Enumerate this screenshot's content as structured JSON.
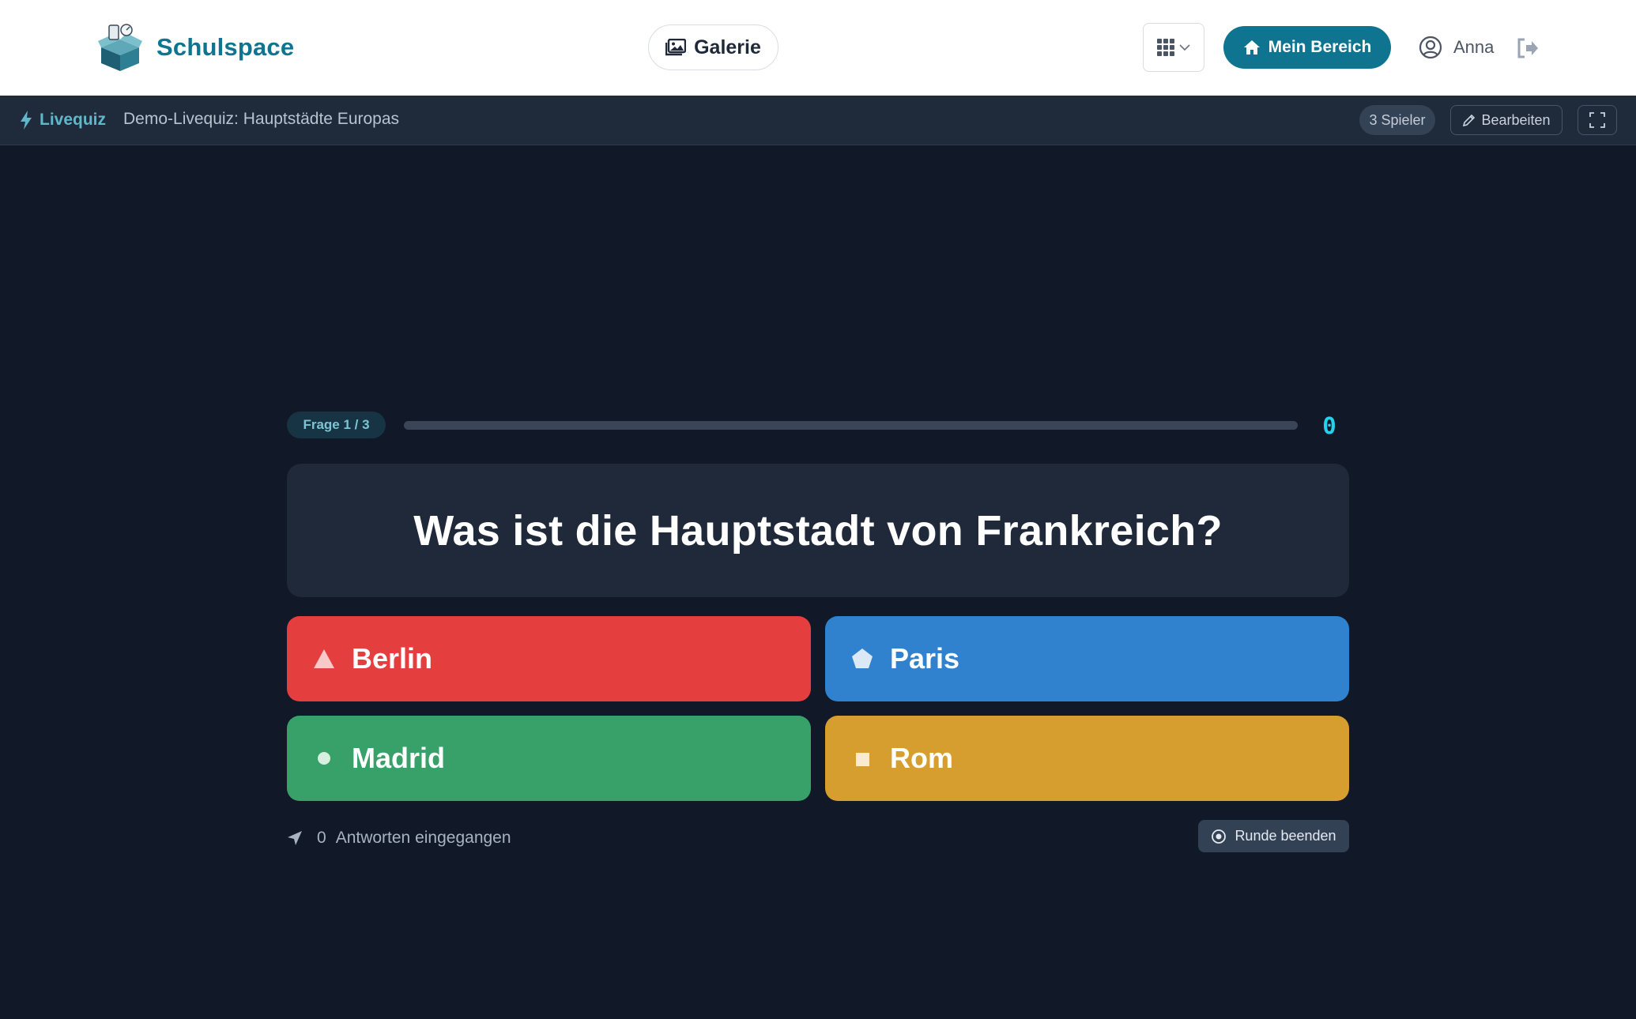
{
  "header": {
    "brand_name": "Schulspace",
    "gallery_label": "Galerie",
    "home_label": "Mein Bereich",
    "user_name": "Anna",
    "brand_color": "#0e7490"
  },
  "subbar": {
    "mode_label": "Livequiz",
    "quiz_title": "Demo-Livequiz: Hauptstädte Europas",
    "players": "3 Spieler",
    "edit_label": "Bearbeiten"
  },
  "quiz": {
    "question_counter": "Frage 1 / 3",
    "timer": "0",
    "progress": 0,
    "question": "Was ist die Hauptstadt von Frankreich?",
    "answers": [
      {
        "label": "Berlin",
        "shape": "triangle-icon",
        "color": "#e53e3e"
      },
      {
        "label": "Paris",
        "shape": "pentagon-icon",
        "color": "#3182ce"
      },
      {
        "label": "Madrid",
        "shape": "circle-icon",
        "color": "#38a169"
      },
      {
        "label": "Rom",
        "shape": "square-icon",
        "color": "#d69e2e"
      }
    ],
    "answers_count": "0",
    "answers_count_label": "Antworten eingegangen",
    "end_round_label": "Runde beenden"
  }
}
